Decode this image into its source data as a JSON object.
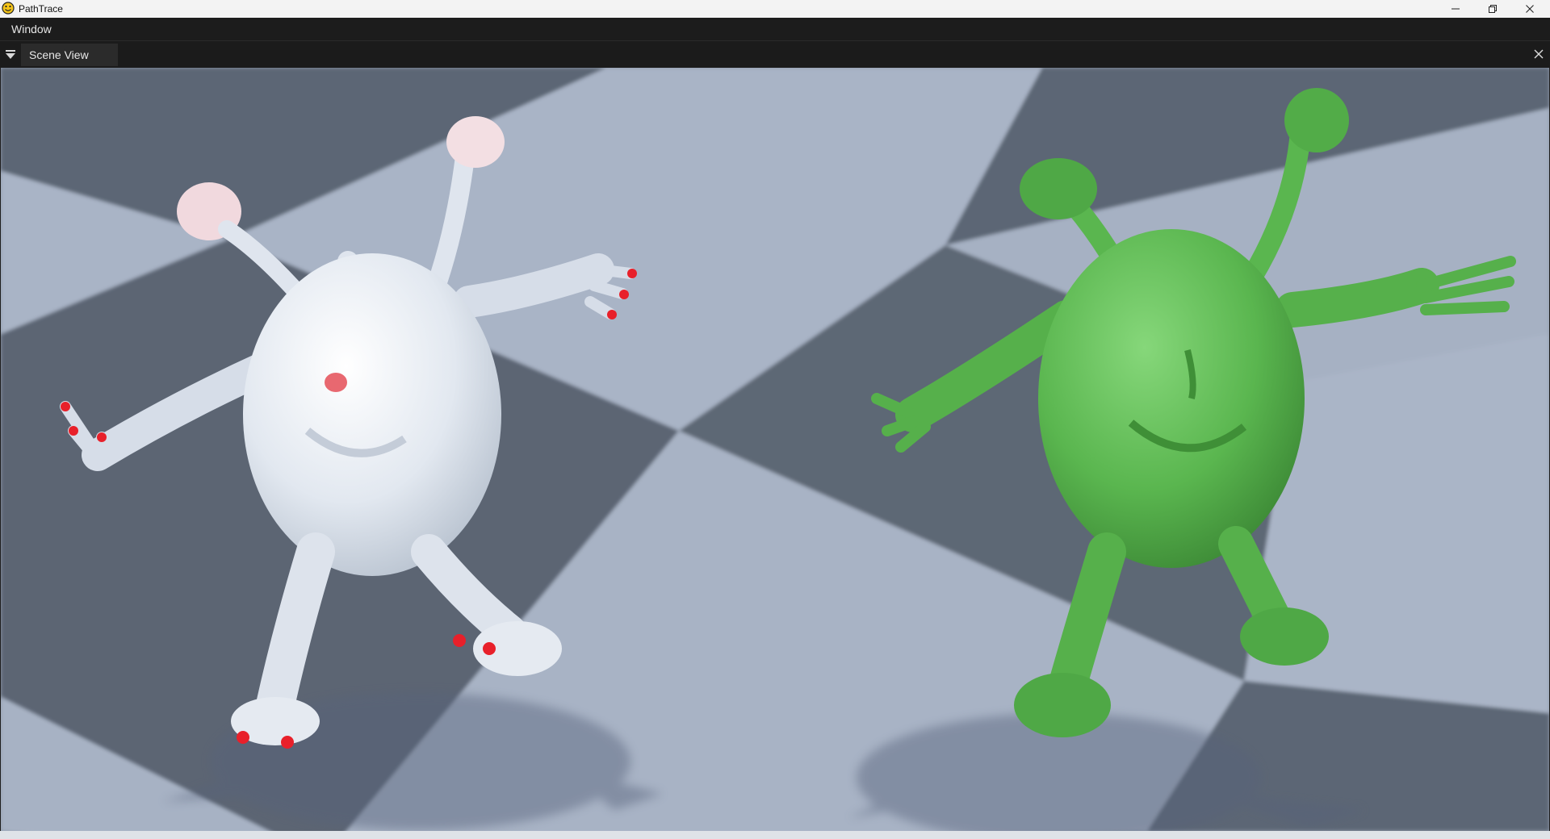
{
  "window": {
    "title": "PathTrace",
    "icon": "smiley-app-icon",
    "controls": [
      "minimize-icon",
      "restore-icon",
      "close-icon"
    ]
  },
  "menubar": {
    "items": [
      "Window"
    ]
  },
  "panel": {
    "tab_label": "Scene View",
    "menu_icon": "dropdown-triangle-icon",
    "close_icon": "close-icon"
  },
  "scene": {
    "floor_light_color": "#a9b4c6",
    "floor_dark_color": "#5c6674",
    "creature_left_color": "#e4e9f0",
    "creature_left_accent": "#e8202a",
    "creature_right_color": "#5ab64f"
  }
}
